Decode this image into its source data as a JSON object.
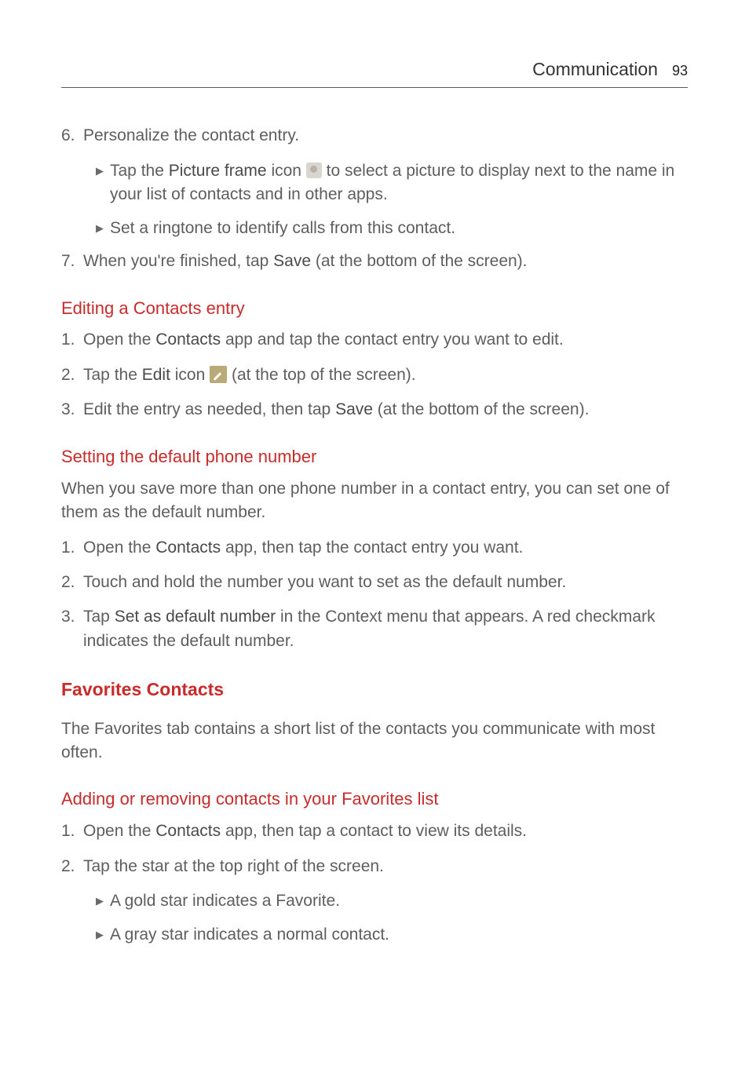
{
  "header": {
    "title": "Communication",
    "page": "93"
  },
  "step6": {
    "num": "6.",
    "text": "Personalize the contact entry.",
    "b1_pre": "Tap the ",
    "b1_bold": "Picture frame",
    "b1_mid": " icon ",
    "b1_post": " to select a picture to display next to the name in your list of contacts and in other apps.",
    "b2": "Set a ringtone to identify calls from this contact."
  },
  "step7": {
    "num": "7.",
    "pre": "When you're finished, tap ",
    "bold": "Save",
    "post": " (at the bottom of the screen)."
  },
  "editing": {
    "heading": "Editing a Contacts entry",
    "s1": {
      "num": "1.",
      "pre": "Open the ",
      "bold": "Contacts",
      "post": " app and tap the contact entry you want to edit."
    },
    "s2": {
      "num": "2.",
      "pre": "Tap the ",
      "bold": "Edit",
      "mid": " icon ",
      "post": " (at the top of the screen)."
    },
    "s3": {
      "num": "3.",
      "pre": "Edit the entry as needed, then tap ",
      "bold": "Save",
      "post": " (at the bottom of the screen)."
    }
  },
  "default": {
    "heading": "Setting the default phone number",
    "intro": "When you save more than one phone number in a contact entry, you can set one of them as the default number.",
    "s1": {
      "num": "1.",
      "pre": "Open the ",
      "bold": "Contacts",
      "post": " app, then tap the contact entry you want."
    },
    "s2": {
      "num": "2.",
      "text": "Touch and hold the number you want to set as the default number."
    },
    "s3": {
      "num": "3.",
      "pre": "Tap ",
      "bold": "Set as default number",
      "post": " in the Context menu that appears. A red checkmark indicates the default number."
    }
  },
  "favorites": {
    "heading": "Favorites Contacts",
    "intro": "The Favorites tab contains a short list of the contacts you communicate with most often."
  },
  "addrem": {
    "heading": "Adding or removing contacts in your Favorites list",
    "s1": {
      "num": "1.",
      "pre": "Open the ",
      "bold": "Contacts",
      "post": " app, then tap a contact to view its details."
    },
    "s2": {
      "num": "2.",
      "text": "Tap the star at the top right of the screen.",
      "b1": "A gold star indicates a Favorite.",
      "b2": "A gray star indicates a normal contact."
    }
  }
}
